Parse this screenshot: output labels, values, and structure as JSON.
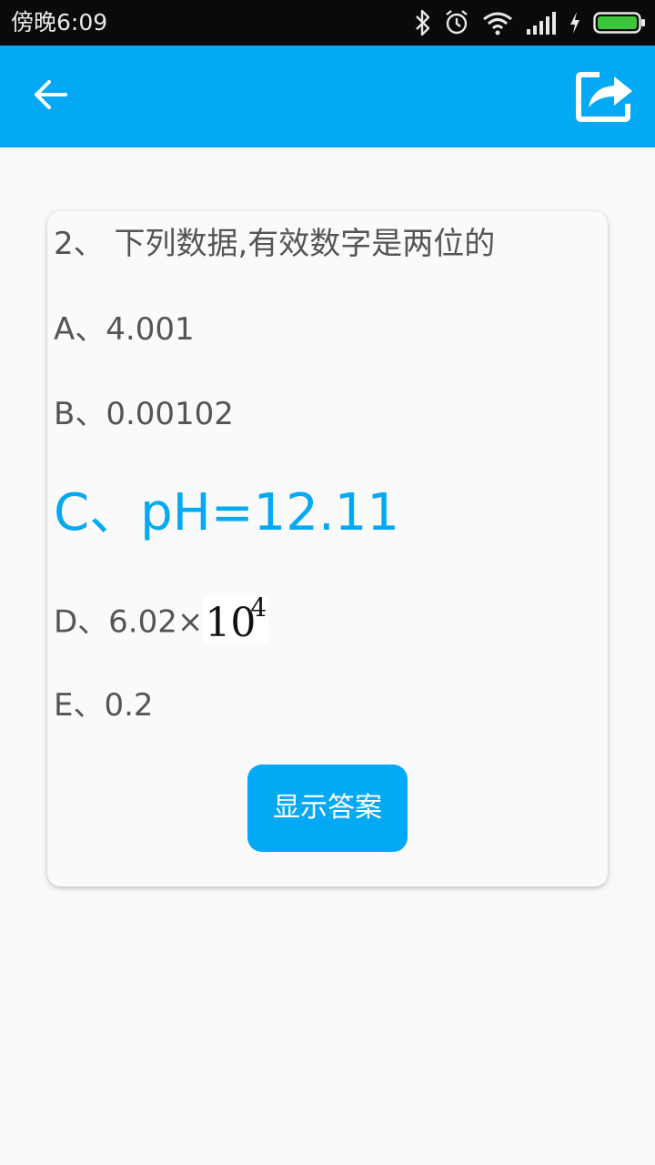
{
  "status_bar": {
    "time": "傍晚6:09",
    "icons": [
      "bluetooth-icon",
      "alarm-icon",
      "wifi-icon",
      "signal-icon",
      "charging-icon",
      "battery-icon"
    ],
    "battery_color": "#3cc43c"
  },
  "app_bar": {
    "color": "#03a9f4",
    "back_icon": "arrow-back-icon",
    "share_icon": "share-icon"
  },
  "question": {
    "title": "2、 下列数据,有效数字是两位的",
    "options": [
      {
        "label": "A、4.001"
      },
      {
        "label": "B、0.00102"
      },
      {
        "label": "C、pH=12.11",
        "selected": true
      },
      {
        "label": "D、6.02×",
        "math_base": "10",
        "math_exp": "4"
      },
      {
        "label": "E、0.2"
      }
    ],
    "show_answer_label": "显示答案"
  }
}
